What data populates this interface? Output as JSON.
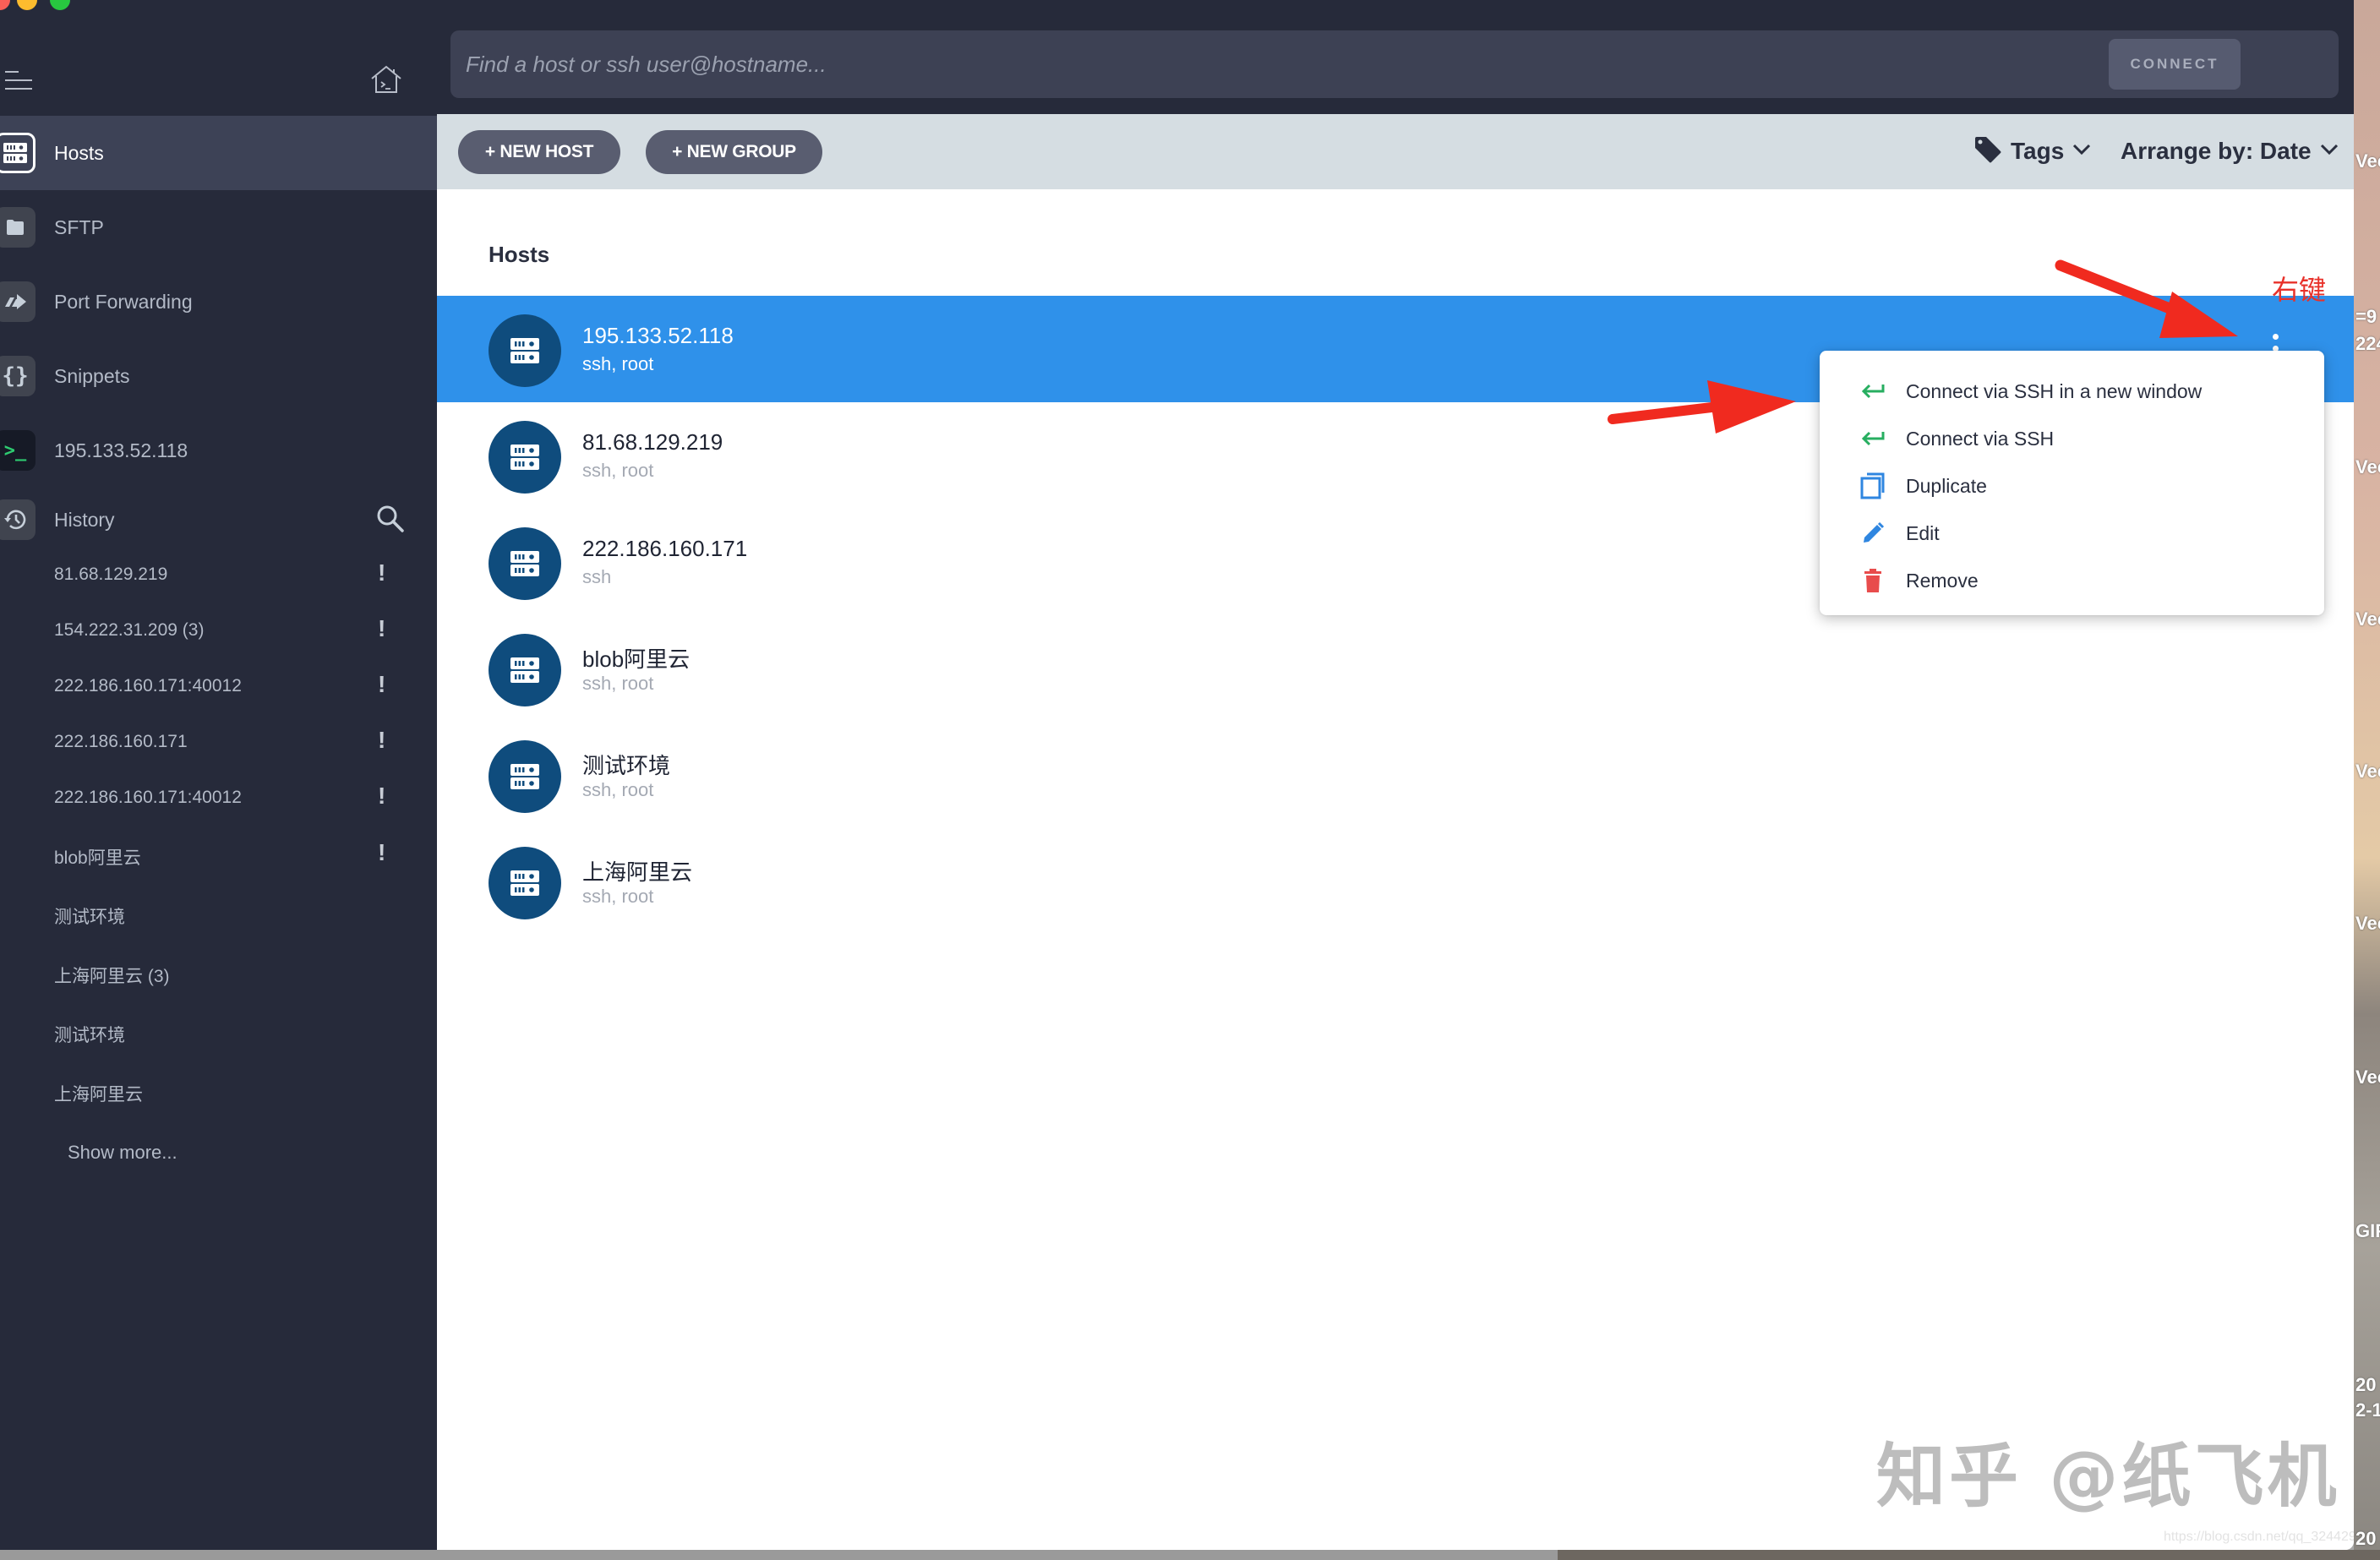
{
  "sidebar": {
    "nav": [
      {
        "label": "Hosts",
        "icon": "server-icon",
        "active": true
      },
      {
        "label": "SFTP",
        "icon": "folder-icon",
        "active": false
      },
      {
        "label": "Port Forwarding",
        "icon": "forward-arrow-icon",
        "active": false
      },
      {
        "label": "Snippets",
        "icon": "curly-braces-icon",
        "active": false
      },
      {
        "label": "195.133.52.118",
        "icon": "terminal-icon",
        "active": false
      }
    ],
    "history": {
      "label": "History",
      "items": [
        {
          "label": "81.68.129.219",
          "warning": true
        },
        {
          "label": "154.222.31.209 (3)",
          "warning": true
        },
        {
          "label": "222.186.160.171:40012",
          "warning": true
        },
        {
          "label": "222.186.160.171",
          "warning": true
        },
        {
          "label": "222.186.160.171:40012",
          "warning": true
        },
        {
          "label": "blob阿里云",
          "warning": true
        },
        {
          "label": "测试环境",
          "warning": false
        },
        {
          "label": "上海阿里云 (3)",
          "warning": false
        },
        {
          "label": "测试环境",
          "warning": false
        },
        {
          "label": "上海阿里云",
          "warning": false
        }
      ],
      "warning_glyph": "!",
      "show_more": "Show more..."
    }
  },
  "topbar": {
    "search_placeholder": "Find a host or ssh user@hostname...",
    "connect_label": "CONNECT"
  },
  "toolbar": {
    "new_host": "+ NEW HOST",
    "new_group": "+ NEW GROUP",
    "tags": "Tags",
    "arrange": "Arrange by: Date"
  },
  "main": {
    "section_title": "Hosts",
    "hosts": [
      {
        "name": "195.133.52.118",
        "sub": "ssh, root",
        "selected": true
      },
      {
        "name": "81.68.129.219",
        "sub": "ssh, root",
        "selected": false
      },
      {
        "name": "222.186.160.171",
        "sub": "ssh",
        "selected": false
      },
      {
        "name": "blob阿里云",
        "sub": "ssh, root",
        "selected": false
      },
      {
        "name": "测试环境",
        "sub": "ssh, root",
        "selected": false
      },
      {
        "name": "上海阿里云",
        "sub": "ssh, root",
        "selected": false
      }
    ]
  },
  "context_menu": {
    "items": [
      {
        "label": "Connect via SSH in a new window",
        "icon": "return-arrow-icon",
        "color": "#27ae60"
      },
      {
        "label": "Connect via SSH",
        "icon": "return-arrow-icon",
        "color": "#27ae60"
      },
      {
        "label": "Duplicate",
        "icon": "duplicate-icon",
        "color": "#2f86e0"
      },
      {
        "label": "Edit",
        "icon": "pencil-icon",
        "color": "#2f86e0"
      },
      {
        "label": "Remove",
        "icon": "trash-icon",
        "color": "#e84c4c"
      }
    ]
  },
  "annotation": {
    "label": "右键",
    "color": "#e8312a"
  },
  "watermark": {
    "text": "知乎 @纸飞机",
    "url": "https://blog.csdn.net/qq_32442973"
  },
  "desktop": {
    "labels": [
      "Vec",
      "=9",
      "224",
      "Vec",
      "Vec",
      "Vec",
      "Vec",
      "Vec",
      "GIF",
      "20",
      "2-1",
      "20"
    ]
  },
  "colors": {
    "sidebar_bg": "#262a3a",
    "selected_row": "#2f91ea",
    "avatar_bg": "#0f4c7d",
    "toolbar_bg": "#d5dde2"
  }
}
